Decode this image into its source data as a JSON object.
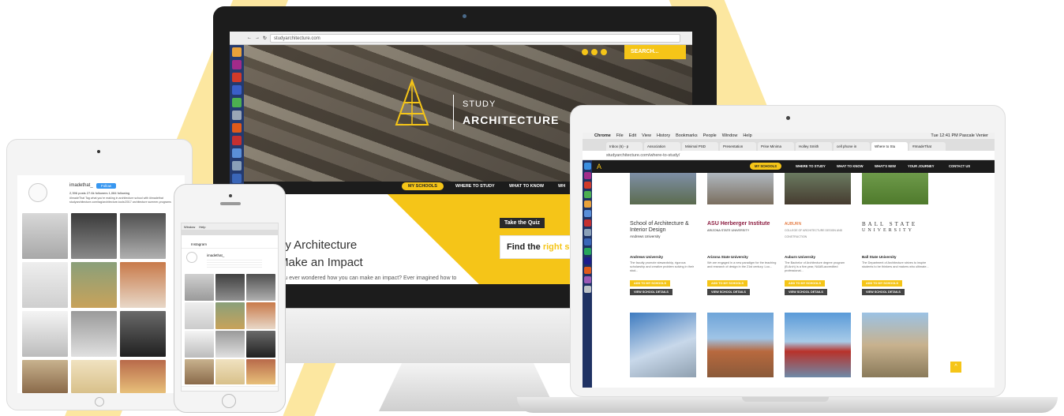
{
  "imac": {
    "url": "studyarchitecture.com",
    "search_label": "SEARCH...",
    "hero": {
      "title_line1": "STUDY",
      "title_line2": "ARCHITECTURE"
    },
    "nav": [
      "MY SCHOOLS",
      "WHERE TO STUDY",
      "WHAT TO KNOW",
      "WH"
    ],
    "content": {
      "heading_line1": "dy Architecture",
      "heading_line2": "Make an Impact",
      "paragraph": "you ever wondered how you can make an impact? Ever imagined how to",
      "quiz": "Take the Quiz",
      "find_prefix": "Find the ",
      "find_highlight": "right scho"
    }
  },
  "laptop": {
    "menubar": [
      "Chrome",
      "File",
      "Edit",
      "View",
      "History",
      "Bookmarks",
      "People",
      "Window",
      "Help"
    ],
    "clock": "Tue 12:41 PM",
    "user": "Pascale Venier",
    "tabs": [
      "Inbox (6) - p",
      "Association",
      "Minimal PSD",
      "Presentation",
      "Prise Minima",
      "Holley Smith",
      "cell phone in",
      "Where to Stu",
      "#ImadeThat"
    ],
    "url": "studyarchitecture.com/where-to-study/",
    "nav": [
      "MY SCHOOLS",
      "WHERE TO STUDY",
      "WHAT TO KNOW",
      "WHAT'S NEW",
      "YOUR JOURNEY",
      "CONTACT US"
    ],
    "schools": [
      {
        "logo": "School of Architecture & Interior Design",
        "logo_sub": "Andrews University",
        "name": "Andrews University",
        "desc": "The faculty promote stewardship, rigorous scholarship and creative problem solving in their stud..."
      },
      {
        "logo": "ASU Herberger Institute",
        "logo_sub": "ARIZONA STATE UNIVERSITY",
        "name": "Arizona State University",
        "desc": "We are engaged in a new paradigm for the teaching and research of design in the 21st century. Loo..."
      },
      {
        "logo": "AUBURN",
        "logo_sub": "COLLEGE OF ARCHITECTURE DESIGN AND CONSTRUCTION",
        "name": "Auburn University",
        "desc": "The Bachelor of Architecture degree program (B.Arch) is a five-year, NAAB-accredited professional..."
      },
      {
        "logo": "BALL STATE",
        "logo_sub": "UNIVERSITY",
        "name": "Ball State University",
        "desc": "The Department of Architecture strives to inspire students to be thinkers and makers who ultimate..."
      }
    ],
    "btn_add": "ADD TO MY SCHOOLS",
    "btn_view": "VIEW SCHOOL DETAILS",
    "scroll_top": "^"
  },
  "tablet": {
    "username": "imadethat_",
    "follow": "Follow",
    "stats": "2,396 posts   27.6k followers   1,084 following",
    "bio": "#ImadeThat Tag what you're making in architecture school with #imadethat studyarchitecture.com/tag/architecture-tools/2017 architecture summer-programs"
  },
  "phone": {
    "menu": [
      "Window",
      "Help"
    ],
    "app": "Instagram",
    "username": "imadethat_"
  },
  "colors": {
    "accent": "#f5c518",
    "dark": "#1c1c1c",
    "instagram_blue": "#3897f0"
  }
}
